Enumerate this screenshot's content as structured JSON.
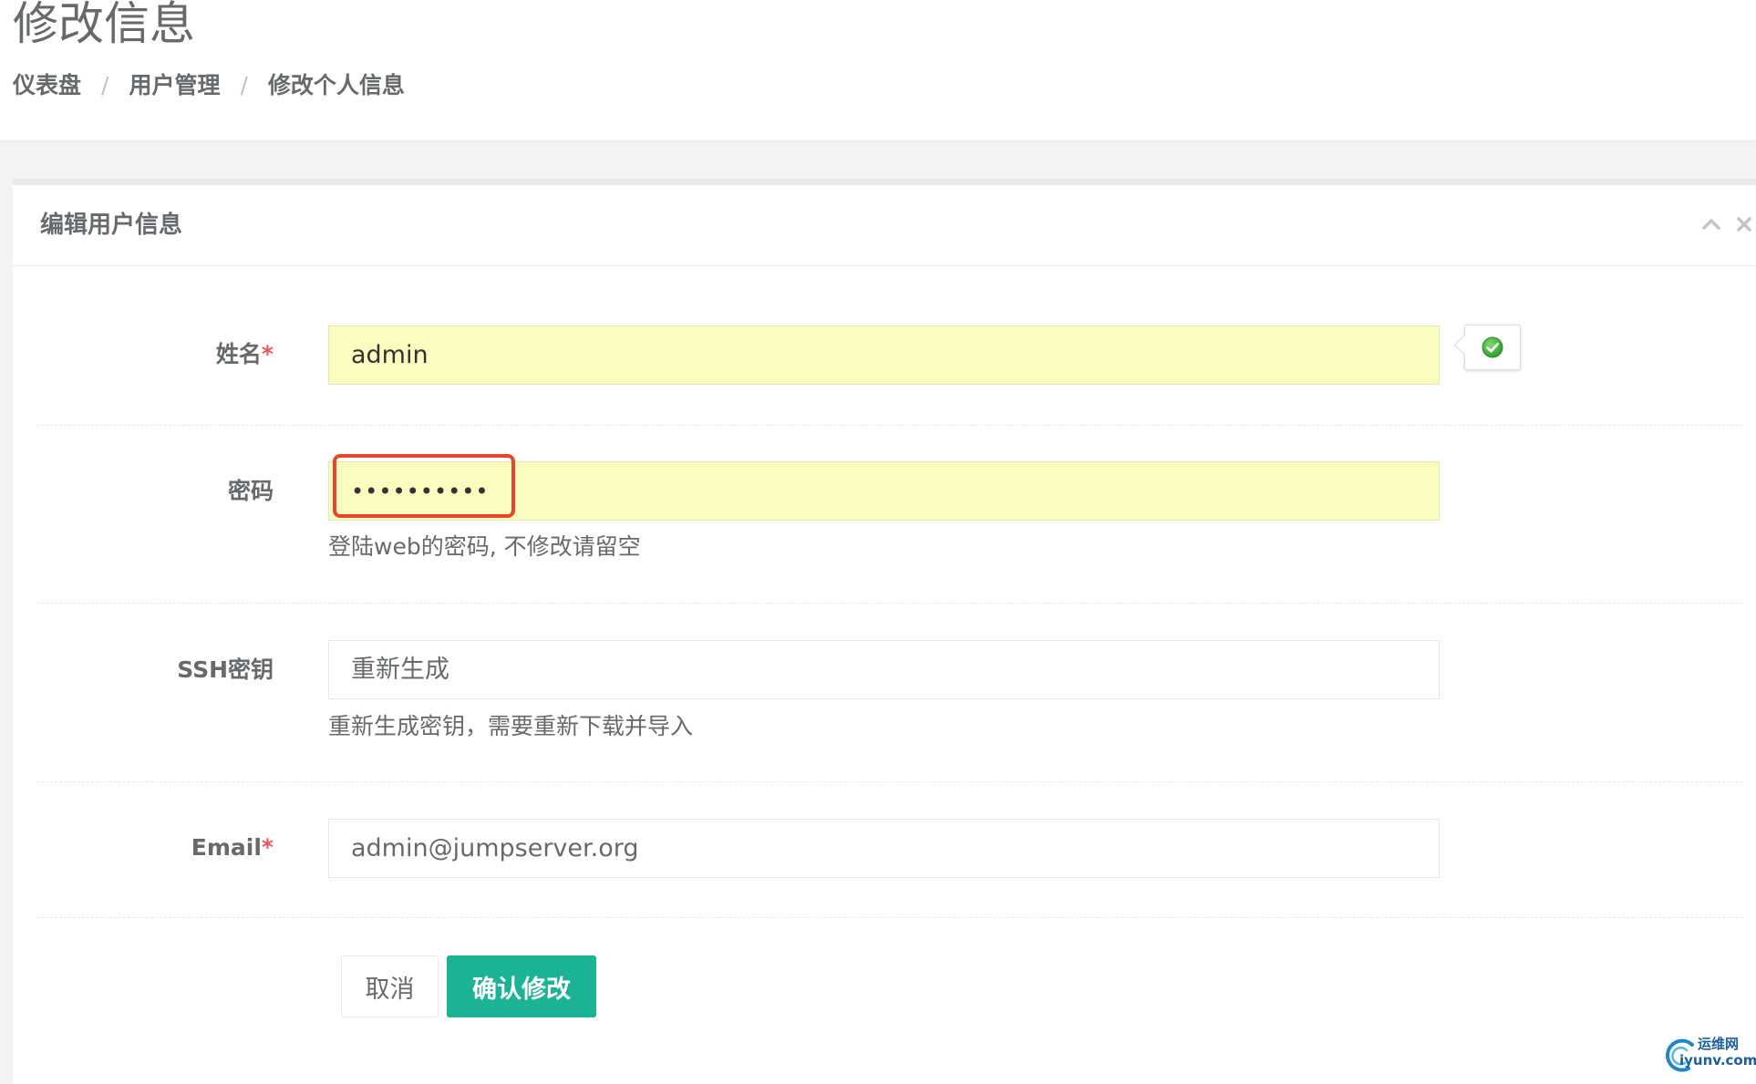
{
  "page": {
    "title": "修改信息"
  },
  "breadcrumb": {
    "items": [
      "仪表盘",
      "用户管理",
      "修改个人信息"
    ],
    "separator": "/"
  },
  "panel": {
    "title": "编辑用户信息",
    "tools": [
      "chevron-up-icon",
      "close-icon"
    ]
  },
  "form": {
    "name": {
      "label": "姓名",
      "required_mark": "*",
      "value": "admin",
      "valid": true
    },
    "password": {
      "label": "密码",
      "value": "••••••••••",
      "help": "登陆web的密码, 不修改请留空"
    },
    "ssh_key": {
      "label": "SSH密钥",
      "placeholder": "重新生成",
      "help": "重新生成密钥，需要重新下载并导入"
    },
    "email": {
      "label": "Email",
      "required_mark": "*",
      "value": "admin@jumpserver.org"
    }
  },
  "actions": {
    "cancel_label": "取消",
    "submit_label": "确认修改"
  },
  "watermark": {
    "line1": "运维网",
    "line2": "iyunv.com"
  },
  "colors": {
    "primary": "#1ab394",
    "required": "#ed5565",
    "autofill": "#fafdbf",
    "annotation": "#e8462a",
    "valid": "#1ab394"
  }
}
